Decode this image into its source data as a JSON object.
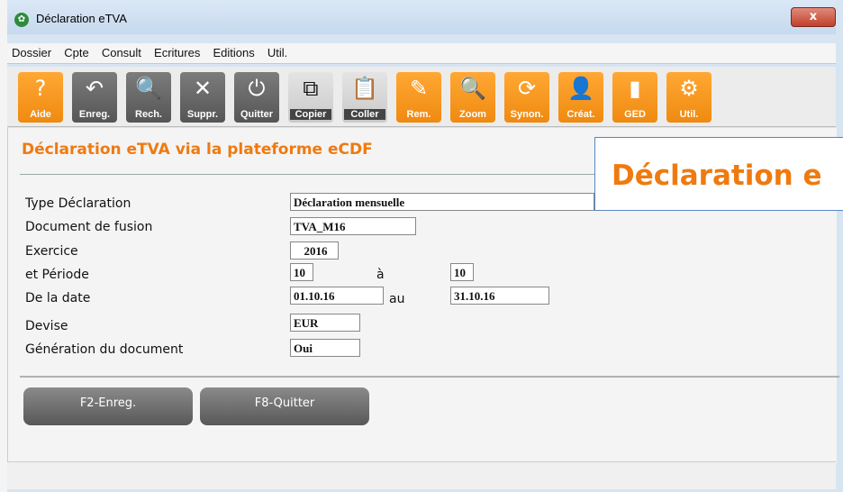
{
  "window": {
    "title": "Déclaration eTVA",
    "close_symbol": "x"
  },
  "menu": [
    "Dossier",
    "Cpte",
    "Consult",
    "Ecritures",
    "Editions",
    "Util."
  ],
  "toolbar": [
    {
      "label": "Aide",
      "icon": "question-icon",
      "glyph": "?"
    },
    {
      "label": "Enreg.",
      "icon": "undo-arrow-icon",
      "glyph": "↶"
    },
    {
      "label": "Rech.",
      "icon": "magnifier-icon",
      "glyph": "🔍"
    },
    {
      "label": "Suppr.",
      "icon": "x-icon",
      "glyph": "✕"
    },
    {
      "label": "Quitter",
      "icon": "power-icon",
      "glyph": "⏻"
    },
    {
      "label": "Copier",
      "icon": "copy-icon",
      "glyph": "⧉"
    },
    {
      "label": "Coller",
      "icon": "clipboard-icon",
      "glyph": "📋"
    },
    {
      "label": "Rem.",
      "icon": "pen-icon",
      "glyph": "✎"
    },
    {
      "label": "Zoom",
      "icon": "zoom-icon",
      "glyph": "🔍"
    },
    {
      "label": "Synon.",
      "icon": "sync-icon",
      "glyph": "⟳"
    },
    {
      "label": "Créat.",
      "icon": "user-icon",
      "glyph": "👤"
    },
    {
      "label": "GED",
      "icon": "folder-icon",
      "glyph": "▮"
    },
    {
      "label": "Util.",
      "icon": "tools-icon",
      "glyph": "⚙"
    }
  ],
  "page": {
    "heading": "Déclaration eTVA via la plateforme eCDF",
    "banner": "Déclaration e"
  },
  "form": {
    "type_label": "Type Déclaration",
    "type_value": "Déclaration mensuelle",
    "doc_label": "Document de fusion",
    "doc_value": "TVA_M16",
    "exercice_label": "Exercice",
    "exercice_value": "2016",
    "periode_label": "et Période",
    "periode_from": "10",
    "periode_sep": "à",
    "periode_to": "10",
    "date_label": "De la date",
    "date_from": "01.10.16",
    "date_sep": "au",
    "date_to": "31.10.16",
    "devise_label": "Devise",
    "devise_value": "EUR",
    "generation_label": "Génération du document",
    "generation_value": "Oui"
  },
  "buttons": {
    "save": "F2-Enreg.",
    "quit": "F8-Quitter"
  },
  "colors": {
    "accent": "#ef7a10",
    "toolbar_orange": "#f5941b",
    "toolbar_grey": "#5e5e5e"
  }
}
